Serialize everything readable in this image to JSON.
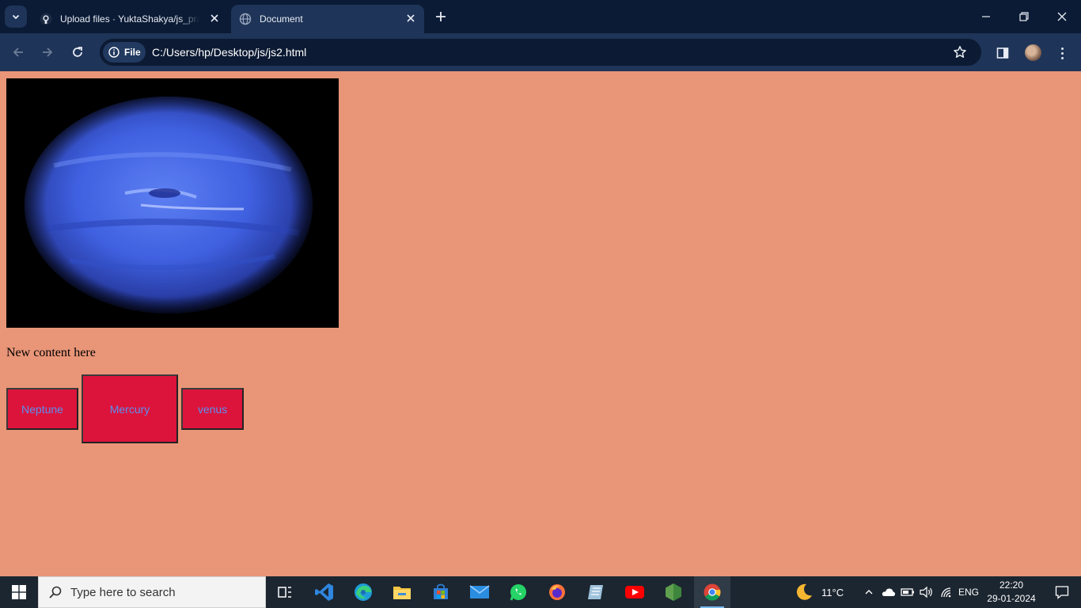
{
  "browser": {
    "tabs": [
      {
        "title": "Upload files · YuktaShakya/js_practice",
        "active": false
      },
      {
        "title": "Document",
        "active": true
      }
    ],
    "site_chip_label": "File",
    "url": "C:/Users/hp/Desktop/js/js2.html"
  },
  "page": {
    "background_color": "#e99578",
    "image_subject": "neptune-planet",
    "content_text": "New content here",
    "buttons": [
      {
        "label": "Neptune"
      },
      {
        "label": "Mercury"
      },
      {
        "label": "venus"
      }
    ],
    "button_color": "#dc143c",
    "button_text_color": "#5b8ff0"
  },
  "taskbar": {
    "search_placeholder": "Type here to search",
    "pinned_icons": [
      "task-view-icon",
      "vscode-icon",
      "edge-icon",
      "file-explorer-icon",
      "microsoft-store-icon",
      "mail-icon",
      "whatsapp-icon",
      "firefox-icon",
      "notepad-icon",
      "youtube-icon",
      "nodejs-icon",
      "chrome-icon"
    ],
    "weather_temp": "11°C",
    "language": "ENG",
    "time": "22:20",
    "date": "29-01-2024"
  }
}
